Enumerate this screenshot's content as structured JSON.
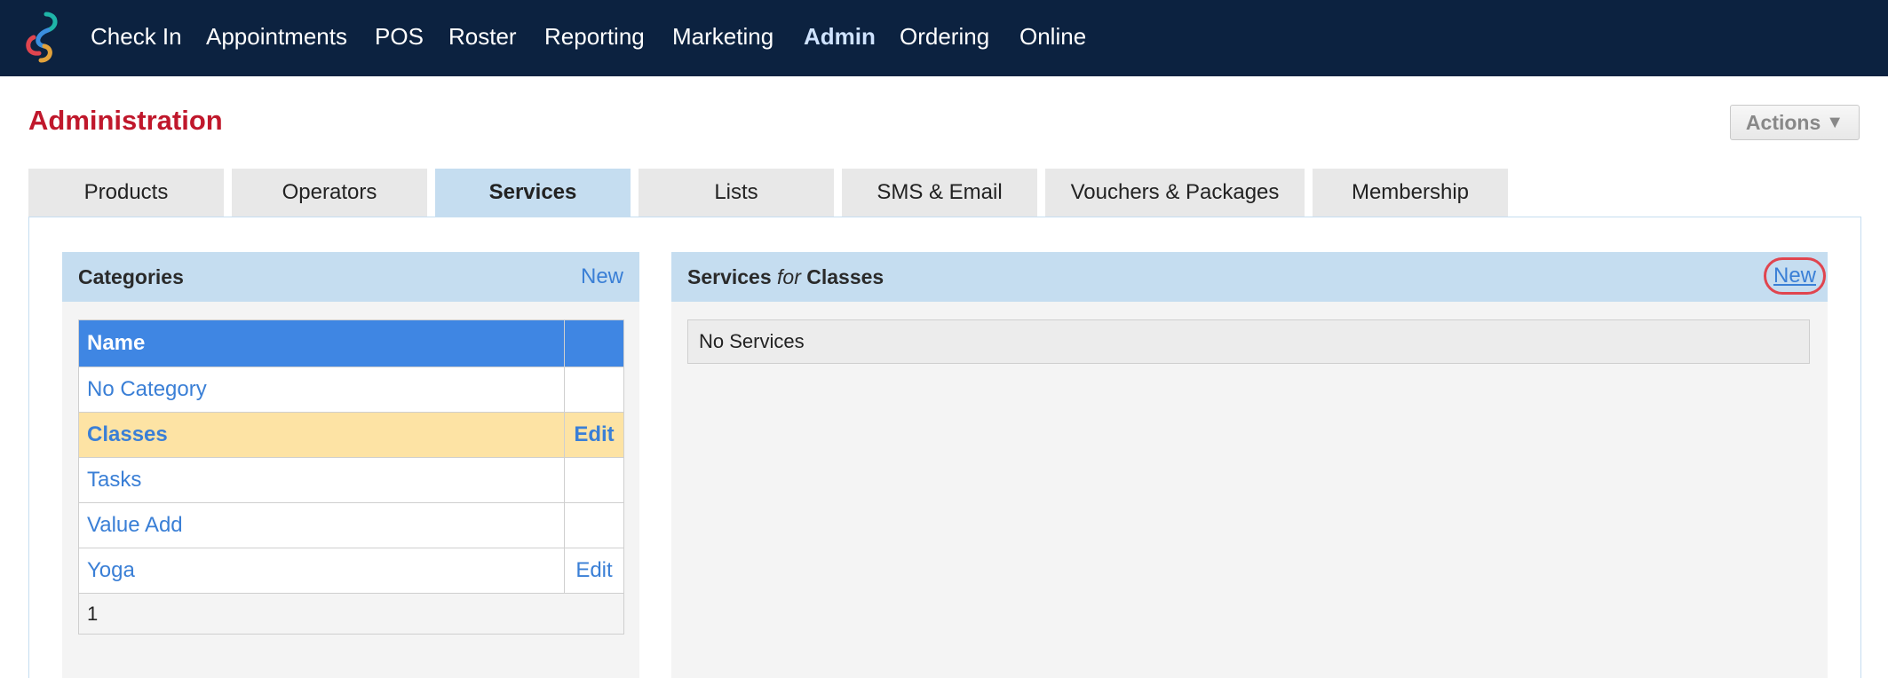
{
  "nav": {
    "items": [
      {
        "label": "Check In",
        "active": false
      },
      {
        "label": "Appointments",
        "active": false
      },
      {
        "label": "POS",
        "active": false
      },
      {
        "label": "Roster",
        "active": false
      },
      {
        "label": "Reporting",
        "active": false
      },
      {
        "label": "Marketing",
        "active": false
      },
      {
        "label": "Admin",
        "active": true
      },
      {
        "label": "Ordering",
        "active": false
      },
      {
        "label": "Online",
        "active": false
      }
    ]
  },
  "header": {
    "title": "Administration",
    "actions_label": "Actions",
    "actions_icon": "caret-down-icon"
  },
  "tabs": [
    {
      "label": "Products",
      "active": false
    },
    {
      "label": "Operators",
      "active": false
    },
    {
      "label": "Services",
      "active": true
    },
    {
      "label": "Lists",
      "active": false
    },
    {
      "label": "SMS & Email",
      "active": false
    },
    {
      "label": "Vouchers & Packages",
      "active": false
    },
    {
      "label": "Membership",
      "active": false
    }
  ],
  "categories": {
    "title": "Categories",
    "new_label": "New",
    "column_name": "Name",
    "column_action": "",
    "rows": [
      {
        "name": "No Category",
        "action": "",
        "selected": false
      },
      {
        "name": "Classes",
        "action": "Edit",
        "selected": true
      },
      {
        "name": "Tasks",
        "action": "",
        "selected": false
      },
      {
        "name": "Value Add",
        "action": "",
        "selected": false
      },
      {
        "name": "Yoga",
        "action": "Edit",
        "selected": false
      }
    ],
    "page": "1"
  },
  "services": {
    "title_prefix": "Services",
    "title_for": "for",
    "title_category": "Classes",
    "new_label": "New",
    "empty_text": "No Services"
  },
  "colors": {
    "nav_background": "#0c2240",
    "title_red": "#c0182c",
    "link_blue": "#3a7fd6",
    "header_light_blue": "#c5ddf0",
    "table_header_blue": "#3f86e3",
    "selected_row": "#fde3a4",
    "highlight_circle": "#e0454f"
  }
}
